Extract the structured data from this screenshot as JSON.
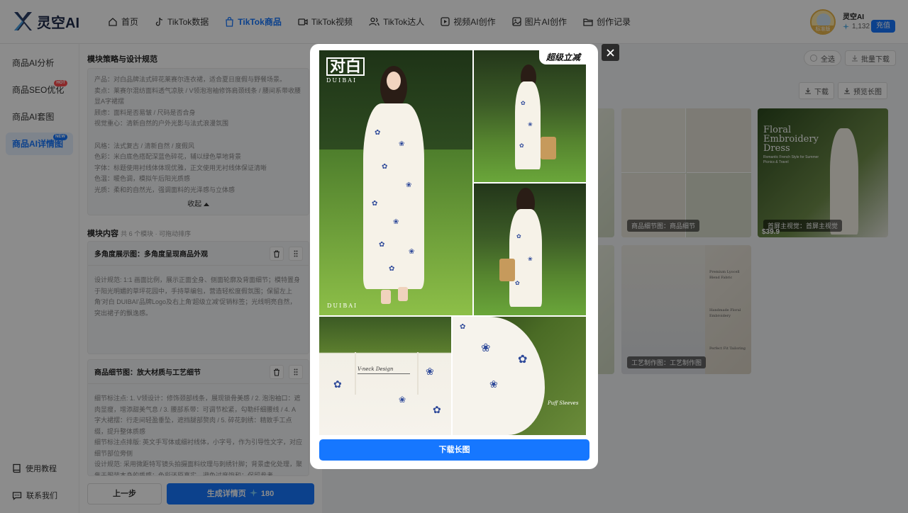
{
  "app": {
    "name": "灵空AI"
  },
  "nav": [
    {
      "label": "首页",
      "icon": "home-icon",
      "active": false
    },
    {
      "label": "TikTok数据",
      "icon": "tiktok-icon",
      "active": false
    },
    {
      "label": "TikTok商品",
      "icon": "shopping-bag-icon",
      "active": true
    },
    {
      "label": "TikTok视频",
      "icon": "video-icon",
      "active": false
    },
    {
      "label": "TikTok达人",
      "icon": "users-icon",
      "active": false
    },
    {
      "label": "视频AI创作",
      "icon": "video-ai-icon",
      "active": false
    },
    {
      "label": "图片AI创作",
      "icon": "image-icon",
      "active": false
    },
    {
      "label": "创作记录",
      "icon": "folder-icon",
      "active": false
    }
  ],
  "user": {
    "name": "灵空AI",
    "points": "1,132",
    "recharge": "充值",
    "plan_badge": "标准版"
  },
  "sidebar": {
    "items": [
      {
        "label": "商品AI分析",
        "tag": ""
      },
      {
        "label": "商品SEO优化",
        "tag": "HOT"
      },
      {
        "label": "商品AI套图",
        "tag": ""
      },
      {
        "label": "商品AI详情图",
        "tag": "NEW"
      }
    ],
    "bottom": [
      {
        "label": "使用教程",
        "icon": "book-icon"
      },
      {
        "label": "联系我们",
        "icon": "chat-icon"
      }
    ]
  },
  "panel": {
    "strategy_title": "模块策略与设计规范",
    "strategy_lines": [
      "产品：对白品牌法式碎花莱赛尔连衣裙，适合夏日度假与野餐场景。",
      "卖点：莱赛尔混纺面料透气凉肤 / V领泡泡袖修饰肩颈线条 / 腰间系带收腰显A字裙摆",
      "顾虑：面料是否易皱 / 尺码是否合身",
      "视觉重心：清新自然的户外光影与法式浪漫氛围",
      "",
      "风格：法式复古 / 清新自然 / 度假风",
      "色彩：米白底色搭配深蓝色碎花，辅以绿色草地背景",
      "字体：标题使用衬线体体现优雅，正文使用无衬线体保证清晰",
      "色温：暖色调，模拟午后阳光质感",
      "光质：柔和的自然光，强调面料的光泽感与立体感"
    ],
    "collapse_label": "收起",
    "modules_title": "模块内容",
    "modules_hint": "共 6 个模块 · 可拖动排序",
    "modules": [
      {
        "title": "多角度展示图：多角度呈现商品外观",
        "body": "设计规范: 1:1 画面比例，展示正面全身、侧面轮廓及背面细节；模特置身于阳光明媚的草坪花园中，手持草编包，营造轻松度假氛围；保留左上角'对白 DUIBAI'品牌Logo及右上角'超级立减'促销标签；光线明亮自然，突出裙子的飘逸感。"
      },
      {
        "title": "商品细节图：放大材质与工艺细节",
        "body": "细节标注点: 1. V领设计：修饰颈部线条，展现锁骨美感 / 2. 泡泡袖口：遮肉显瘦，增添甜美气息 / 3. 腰部系带：可调节松紧，勾勒纤细腰线 / 4. A字大裙摆：行走间轻盈垂坠，遮挡腿部赘肉 / 5. 碎花刺绣：精致手工点缀，提升整体质感\n细节标注点排版: 英文手写体或细衬线体，小字号，作为引导性文字，对应细节部位旁侧\n设计规范: 采用微距特写镜头拍摄面料纹理与刺绣针脚；背景虚化处理，聚焦于服装本身的质感；色彩还原真实，避免过度饱和；保留参考"
      }
    ],
    "prev_label": "上一步",
    "generate_label": "生成详情页",
    "generate_cost": "180"
  },
  "main": {
    "select_all": "全选",
    "batch_download": "批量下载",
    "download": "下载",
    "preview_long": "预览长图",
    "cards": [
      {
        "caption": "商品细节图：商品细节"
      },
      {
        "caption": "首屏主视觉：首屏主视觉",
        "title_lines": [
          "Floral",
          "Embroidery",
          "Dress"
        ],
        "subtitle": "Romantic French Style for Summer Picnics & Travel",
        "price": "$39.9"
      },
      {
        "caption": "工艺制作图：工艺制作图",
        "notes": [
          "Premium Lyocell Blend Fabric",
          "Handmade Floral Embroidery",
          "Perfect Fit Tailoring"
        ]
      }
    ]
  },
  "modal": {
    "brand_cn": "对白",
    "brand_en": "DUIBAI",
    "brand_footer": "DUIBAI",
    "sale_tag": "超级立减",
    "detail_label_1": "V-neck Design",
    "detail_label_2": "Puff Sleeves",
    "download_long": "下载长图",
    "colors": {
      "primary": "#1677ff",
      "dress": "#f6f2e8",
      "embroidery": "#2f4a9a",
      "grass": "#79a741"
    }
  }
}
